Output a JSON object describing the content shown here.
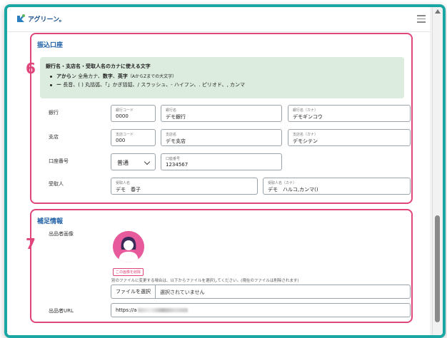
{
  "header": {
    "logo_text": "アグリーン。"
  },
  "bank_section": {
    "title": "振込口座",
    "step_number": "6",
    "info": {
      "title": "銀行名・支店名・受取人名のカナに使える文字",
      "line1_bold": "アから",
      "line1_a": "ン 全角カナ、",
      "line1_num": "数字",
      "line1_sep": "、",
      "line1_eng": "英字",
      "line1_note": "（AからZまでの大文字）",
      "line2_bold": "ー",
      "line2_rest": " 長音、( ) 丸括弧、「」かぎ括弧、/ スラッシュ、- ハイフン、. ピリオド、, カンマ"
    },
    "rows": {
      "bank": {
        "label": "銀行",
        "code": {
          "placeholder": "銀行コード",
          "value": "0000"
        },
        "name": {
          "placeholder": "銀行名",
          "value": "デモ銀行"
        },
        "kana": {
          "placeholder": "銀行名（カナ）",
          "value": "デモギンコウ"
        }
      },
      "branch": {
        "label": "支店",
        "code": {
          "placeholder": "支店コード",
          "value": "000"
        },
        "name": {
          "placeholder": "支店名",
          "value": "デモ支店"
        },
        "kana": {
          "placeholder": "支店名（カナ）",
          "value": "デモシテン"
        }
      },
      "account": {
        "label": "口座番号",
        "type": "普通",
        "number": {
          "placeholder": "口座番号",
          "value": "1234567"
        }
      },
      "recipient": {
        "label": "受取人",
        "name": {
          "placeholder": "受取人名",
          "value": "デモ　春子"
        },
        "kana": {
          "placeholder": "受取人名（カナ）",
          "value": "デモ　ハルコ,カンマ()"
        }
      }
    }
  },
  "extra_section": {
    "title": "補足情報",
    "step_number": "7",
    "image_label": "出品者画像",
    "delete_label": "この画像を削除",
    "file_note": "別のファイルに変更する場合は、以下からファイルを選択してください。(現在のファイルは削除されます)",
    "file_button": "ファイルを選択",
    "file_status": "選択されていません",
    "url_label": "出品者URL",
    "url_value": "https://a"
  },
  "colors": {
    "accent": "#e0457b",
    "title": "#1d5fa5",
    "info_bg": "#dcecdf",
    "frame": "#1aa7a4"
  }
}
